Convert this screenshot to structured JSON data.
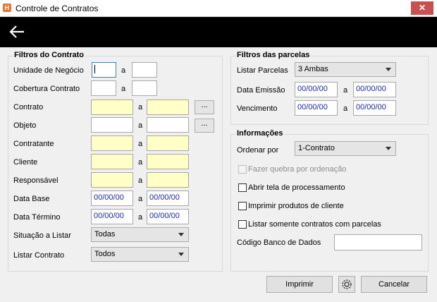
{
  "window": {
    "title": "Controle de Contratos",
    "close_glyph": "✕",
    "app_icon": "H"
  },
  "toolbar": {
    "back_icon": "arrow-left-icon"
  },
  "contrato": {
    "title": "Filtros do Contrato",
    "sep": "a",
    "unidade_label": "Unidade de Negócio",
    "cobertura_label": "Cobertura Contrato",
    "contrato_label": "Contrato",
    "objeto_label": "Objeto",
    "contratante_label": "Contratante",
    "cliente_label": "Cliente",
    "responsavel_label": "Responsável",
    "data_base_label": "Data Base",
    "data_base_from": "00/00/00",
    "data_base_to": "00/00/00",
    "data_termino_label": "Data Término",
    "data_termino_from": "00/00/00",
    "data_termino_to": "00/00/00",
    "situacao_label": "Situação a Listar",
    "situacao_value": "Todas",
    "listar_label": "Listar Contrato",
    "listar_value": "Todos",
    "dots": "..."
  },
  "parcelas": {
    "title": "Filtros das parcelas",
    "sep": "a",
    "listar_label": "Listar Parcelas",
    "listar_value": "3 Ambas",
    "emissao_label": "Data Emissão",
    "emissao_from": "00/00/00",
    "emissao_to": "00/00/00",
    "vencimento_label": "Vencimento",
    "vencimento_from": "00/00/00",
    "vencimento_to": "00/00/00"
  },
  "info": {
    "title": "Informações",
    "ordenar_label": "Ordenar por",
    "ordenar_value": "1-Contrato",
    "quebra_label": "Fazer quebra por ordenação",
    "abrir_label": "Abrir tela de processamento",
    "imprimir_produtos_label": "Imprimir produtos de cliente",
    "listar_somente_label": "Listar somente contratos com parcelas",
    "codigo_label": "Código Banco de Dados",
    "codigo_value": ""
  },
  "buttons": {
    "imprimir": "Imprimir",
    "cancelar": "Cancelar",
    "gear_icon": "gear-icon"
  }
}
